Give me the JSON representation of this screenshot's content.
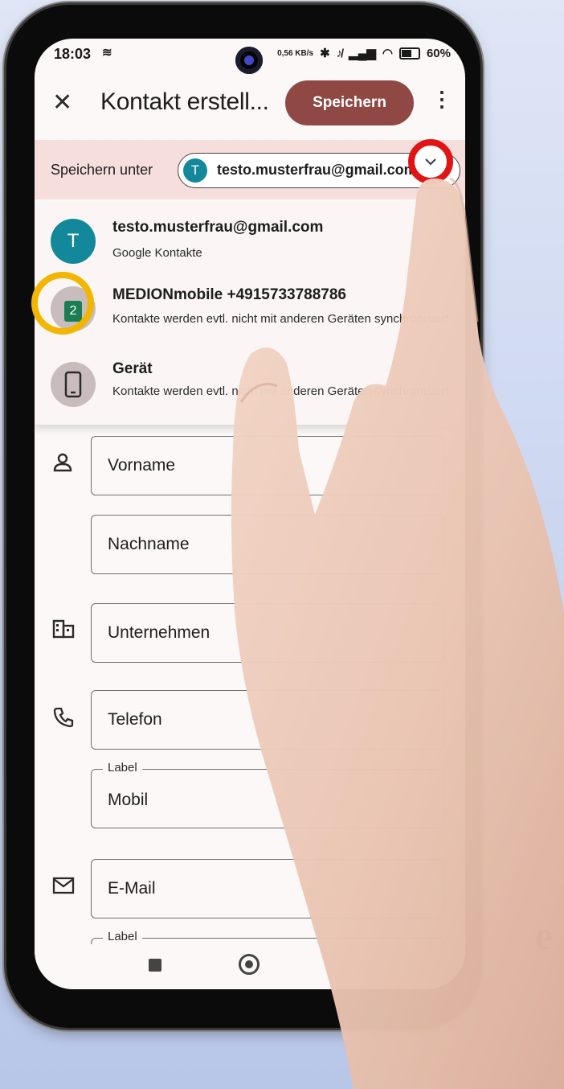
{
  "status": {
    "time": "18:03",
    "notification_icon": "≋",
    "net_speed": "0,56 KB/s",
    "battery": "60%"
  },
  "appbar": {
    "close_icon": "close-icon",
    "title": "Kontakt erstell...",
    "save_label": "Speichern",
    "more_icon": "more-vert-icon"
  },
  "save_under": {
    "label": "Speichern unter",
    "avatar_letter": "T",
    "account": "testo.musterfrau@gmail.com",
    "avatar_color": "#12889a"
  },
  "accounts": [
    {
      "avatar": "T",
      "name": "testo.musterfrau@gmail.com",
      "sub": "Google Kontakte",
      "avatar_color": "#12889a"
    },
    {
      "avatar": "2",
      "name": "MEDIONmobile +4915733788786",
      "sub": "Kontakte werden evtl. nicht mit anderen Geräten synchronisiert",
      "avatar_color": "#c9bcbc"
    },
    {
      "avatar": "",
      "name": "Gerät",
      "sub": "Kontakte werden evtl. nicht mit anderen Geräten synchronisiert",
      "avatar_color": "#c9bcbc"
    }
  ],
  "form": {
    "first_name": "Vorname",
    "last_name": "Nachname",
    "company": "Unternehmen",
    "phone": "Telefon",
    "phone_label_caption": "Label",
    "phone_label_value": "Mobil",
    "email": "E-Mail",
    "email_label_caption": "Label"
  },
  "colors": {
    "save_button": "#8f4843",
    "highlight_red": "#e11414",
    "highlight_yellow": "#f2b600",
    "save_under_bg": "#f6dedc"
  },
  "background_text": "e"
}
